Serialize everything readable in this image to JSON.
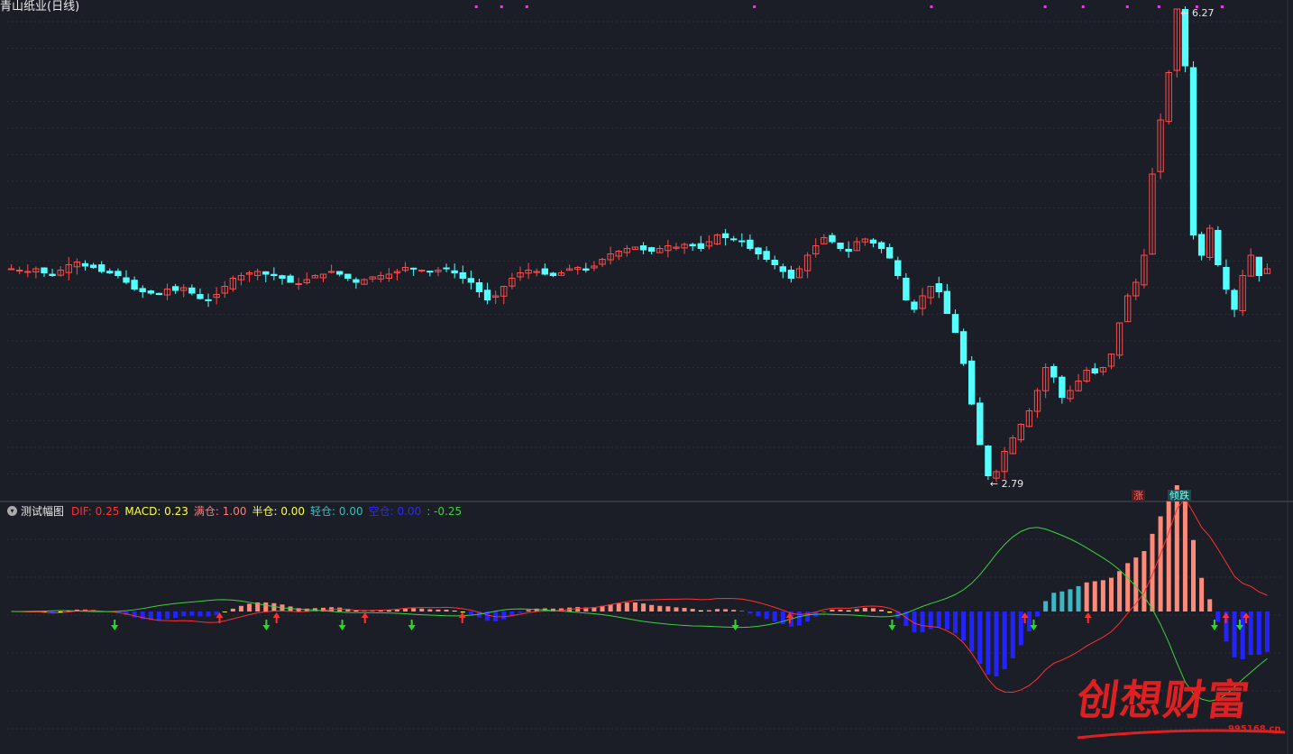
{
  "main_panel": {
    "title": "青山纸业(日线)"
  },
  "indicator_panel": {
    "title": "测试幅图",
    "items": [
      {
        "label": "DIF",
        "value": "0.25",
        "color": "#ff3030"
      },
      {
        "label": "MACD",
        "value": "0.23",
        "color": "#ffff40"
      },
      {
        "label": "满仓",
        "value": "1.00",
        "color": "#ff7a7a"
      },
      {
        "label": "半仓",
        "value": "0.00",
        "color": "#ffff40"
      },
      {
        "label": "轻仓",
        "value": "0.00",
        "color": "#2fbfbf"
      },
      {
        "label": "空仓",
        "value": "0.00",
        "color": "#2a2aff"
      },
      {
        "label": "",
        "value": "-0.25",
        "color": "#3cd23c"
      }
    ]
  },
  "tags": {
    "rise": "涨",
    "pattern": "倾跌"
  },
  "watermark": {
    "text": "创想财富",
    "url": "995168.cn"
  },
  "chart_data": [
    {
      "type": "candlestick",
      "title": "青山纸业(日线)",
      "price_labels": {
        "high": "6.27",
        "low": "2.79"
      },
      "max_price": 6.27,
      "min_price": 2.79,
      "close_series": [
        4.35,
        4.34,
        4.33,
        4.35,
        4.32,
        4.3,
        4.34,
        4.38,
        4.4,
        4.37,
        4.36,
        4.33,
        4.32,
        4.3,
        4.25,
        4.2,
        4.18,
        4.17,
        4.16,
        4.2,
        4.19,
        4.21,
        4.17,
        4.13,
        4.12,
        4.16,
        4.22,
        4.28,
        4.3,
        4.32,
        4.33,
        4.31,
        4.3,
        4.28,
        4.25,
        4.24,
        4.27,
        4.3,
        4.31,
        4.33,
        4.31,
        4.28,
        4.25,
        4.27,
        4.29,
        4.3,
        4.31,
        4.33,
        4.36,
        4.35,
        4.34,
        4.33,
        4.34,
        4.35,
        4.32,
        4.28,
        4.25,
        4.18,
        4.12,
        4.15,
        4.22,
        4.28,
        4.32,
        4.34,
        4.33,
        4.31,
        4.3,
        4.32,
        4.35,
        4.36,
        4.34,
        4.37,
        4.42,
        4.46,
        4.48,
        4.5,
        4.51,
        4.49,
        4.48,
        4.5,
        4.52,
        4.51,
        4.53,
        4.52,
        4.5,
        4.55,
        4.6,
        4.58,
        4.57,
        4.55,
        4.5,
        4.46,
        4.42,
        4.38,
        4.33,
        4.28,
        4.35,
        4.45,
        4.52,
        4.58,
        4.55,
        4.5,
        4.48,
        4.55,
        4.57,
        4.54,
        4.5,
        4.43,
        4.3,
        4.12,
        4.05,
        4.15,
        4.22,
        4.18,
        4.02,
        3.88,
        3.65,
        3.35,
        3.05,
        2.82,
        2.85,
        3.0,
        3.1,
        3.2,
        3.3,
        3.45,
        3.62,
        3.55,
        3.4,
        3.45,
        3.52,
        3.6,
        3.58,
        3.62,
        3.72,
        3.95,
        4.15,
        4.25,
        4.45,
        5.05,
        5.45,
        5.8,
        6.27,
        5.85,
        4.6,
        4.45,
        4.65,
        4.38,
        4.2,
        4.05,
        4.3,
        4.45,
        4.3,
        4.35
      ]
    },
    {
      "type": "bar",
      "title": "测试幅图",
      "series": [
        {
          "name": "DIF",
          "last": 0.25
        },
        {
          "name": "MACD",
          "last": 0.23
        }
      ],
      "signals": [
        {
          "side": "up",
          "positions": [
            0.168,
            0.213,
            0.283,
            0.36,
            0.619,
            0.805,
            0.855,
            0.964,
            0.98
          ]
        },
        {
          "side": "down",
          "positions": [
            0.085,
            0.205,
            0.265,
            0.32,
            0.576,
            0.7,
            0.812,
            0.955,
            0.975
          ]
        }
      ]
    }
  ]
}
